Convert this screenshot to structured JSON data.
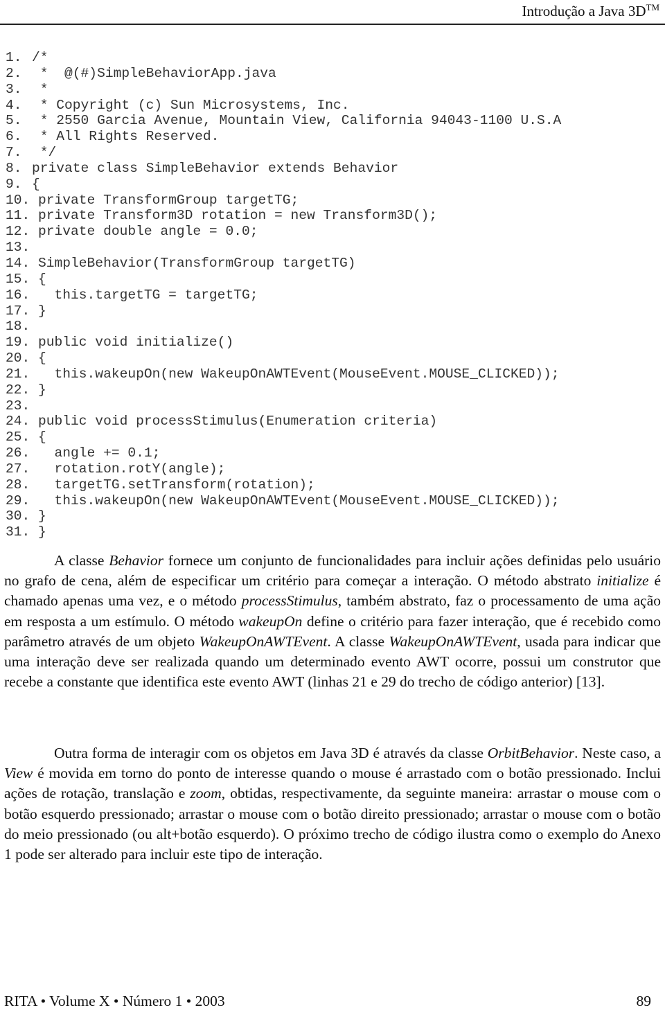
{
  "header": {
    "title": "Introdução a Java 3D",
    "trademark": "TM"
  },
  "code": {
    "lines": [
      {
        "num": "1.",
        "text": "/*"
      },
      {
        "num": "2.",
        "text": " *  @(#)SimpleBehaviorApp.java"
      },
      {
        "num": "3.",
        "text": " *"
      },
      {
        "num": "4.",
        "text": " * Copyright (c) Sun Microsystems, Inc."
      },
      {
        "num": "5.",
        "text": " * 2550 Garcia Avenue, Mountain View, California 94043-1100 U.S.A"
      },
      {
        "num": "6.",
        "text": " * All Rights Reserved."
      },
      {
        "num": "7.",
        "text": " */"
      },
      {
        "num": "8.",
        "text": "private class SimpleBehavior extends Behavior"
      },
      {
        "num": "9.",
        "text": "{"
      },
      {
        "num": "10.",
        "text": "private TransformGroup targetTG;"
      },
      {
        "num": "11.",
        "text": "private Transform3D rotation = new Transform3D();"
      },
      {
        "num": "12.",
        "text": "private double angle = 0.0;"
      },
      {
        "num": "13.",
        "text": ""
      },
      {
        "num": "14.",
        "text": "SimpleBehavior(TransformGroup targetTG)"
      },
      {
        "num": "15.",
        "text": "{"
      },
      {
        "num": "16.",
        "text": "  this.targetTG = targetTG;"
      },
      {
        "num": "17.",
        "text": "}"
      },
      {
        "num": "18.",
        "text": ""
      },
      {
        "num": "19.",
        "text": "public void initialize()"
      },
      {
        "num": "20.",
        "text": "{"
      },
      {
        "num": "21.",
        "text": "  this.wakeupOn(new WakeupOnAWTEvent(MouseEvent.MOUSE_CLICKED));"
      },
      {
        "num": "22.",
        "text": "}"
      },
      {
        "num": "23.",
        "text": ""
      },
      {
        "num": "24.",
        "text": "public void processStimulus(Enumeration criteria)"
      },
      {
        "num": "25.",
        "text": "{"
      },
      {
        "num": "26.",
        "text": "  angle += 0.1;"
      },
      {
        "num": "27.",
        "text": "  rotation.rotY(angle);"
      },
      {
        "num": "28.",
        "text": "  targetTG.setTransform(rotation);"
      },
      {
        "num": "29.",
        "text": "  this.wakeupOn(new WakeupOnAWTEvent(MouseEvent.MOUSE_CLICKED));"
      },
      {
        "num": "30.",
        "text": "}"
      },
      {
        "num": "31.",
        "text": "}"
      }
    ]
  },
  "paragraphs": [
    {
      "segments": [
        {
          "t": "A classe ",
          "i": false
        },
        {
          "t": "Behavior",
          "i": true
        },
        {
          "t": " fornece um conjunto de funcionalidades para incluir ações definidas pelo usuário no grafo de cena, além de especificar um critério para começar a interação. O método abstrato ",
          "i": false
        },
        {
          "t": "initialize",
          "i": true
        },
        {
          "t": " é chamado apenas uma vez, e o método ",
          "i": false
        },
        {
          "t": "processStimulus",
          "i": true
        },
        {
          "t": ", também abstrato, faz o processamento de uma ação em resposta a um estímulo. O método ",
          "i": false
        },
        {
          "t": "wakeupOn",
          "i": true
        },
        {
          "t": " define o critério para fazer interação, que é recebido como parâmetro através de um objeto ",
          "i": false
        },
        {
          "t": "WakeupOnAWTEvent",
          "i": true
        },
        {
          "t": ". A classe ",
          "i": false
        },
        {
          "t": "WakeupOnAWTEvent",
          "i": true
        },
        {
          "t": ", usada para indicar que uma interação deve ser realizada quando um determinado evento AWT ocorre, possui um construtor que recebe a constante que identifica este evento AWT (linhas 21 e 29 do trecho de código anterior) [13].",
          "i": false
        }
      ]
    },
    {
      "segments": [
        {
          "t": "Outra forma de interagir com os objetos em Java 3D é através da classe ",
          "i": false
        },
        {
          "t": "OrbitBehavior",
          "i": true
        },
        {
          "t": ". Neste caso, a ",
          "i": false
        },
        {
          "t": "View",
          "i": true
        },
        {
          "t": " é movida em torno do ponto de interesse quando o mouse é arrastado com o botão pressionado. Inclui ações de rotação, translação e ",
          "i": false
        },
        {
          "t": "zoom",
          "i": true
        },
        {
          "t": ", obtidas, respectivamente, da seguinte maneira: arrastar o mouse com o botão esquerdo pressionado; arrastar o mouse com o botão direito pressionado; arrastar o mouse com o botão do meio pressionado (ou alt+botão esquerdo). O próximo trecho de código ilustra como o exemplo do Anexo 1 pode ser alterado para incluir este tipo de interação.",
          "i": false
        }
      ]
    }
  ],
  "footer": {
    "journal": "RITA • Volume X • Número 1 • 2003",
    "page_number": "89"
  }
}
